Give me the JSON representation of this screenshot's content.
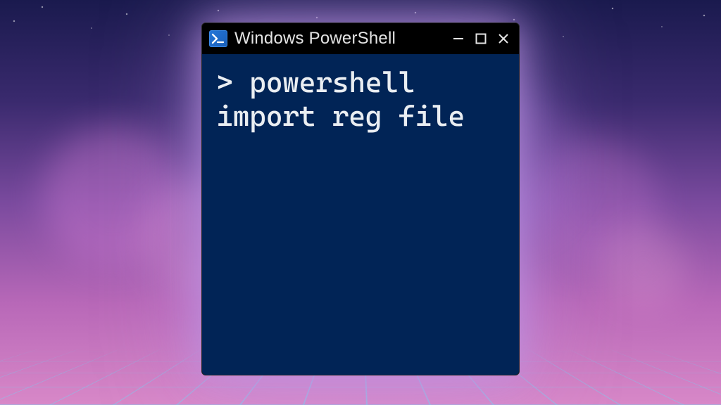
{
  "window": {
    "title": "Windows PowerShell",
    "icon_name": "powershell-icon"
  },
  "terminal": {
    "prompt": "> ",
    "command": "powershell import reg file",
    "background_color": "#012456",
    "text_color": "#eaeef2"
  },
  "controls": {
    "minimize_label": "Minimize",
    "maximize_label": "Maximize",
    "close_label": "Close"
  }
}
